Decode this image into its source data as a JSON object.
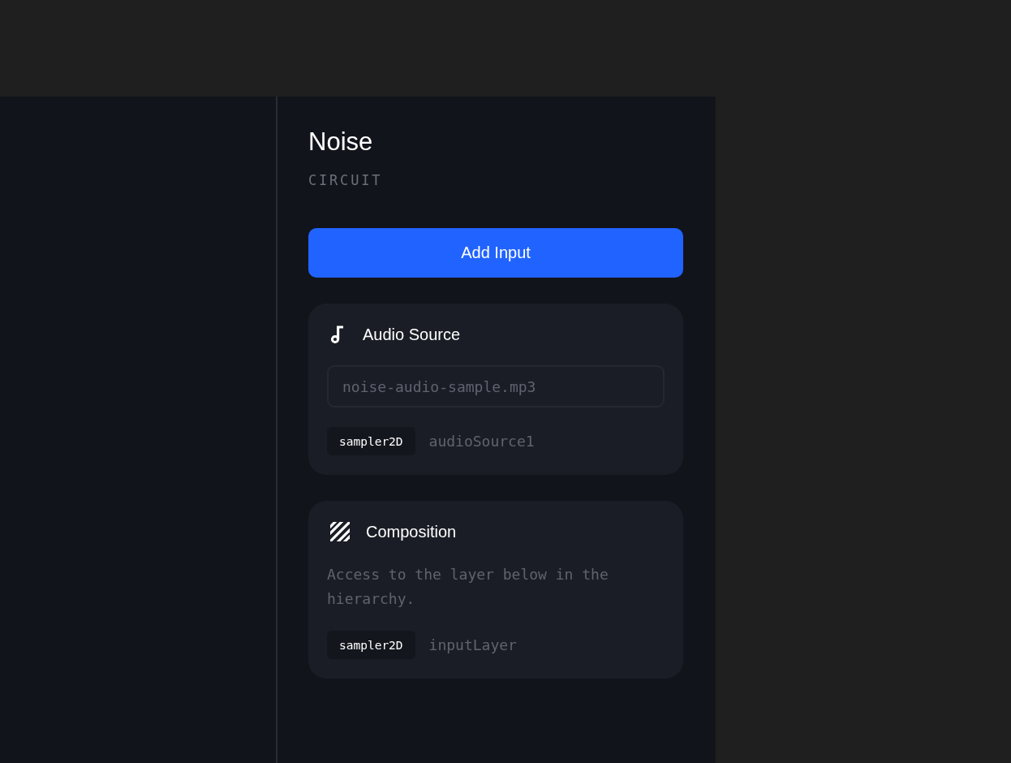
{
  "panel": {
    "title": "Noise",
    "subtitle": "CIRCUIT"
  },
  "add_button": {
    "label": "Add Input"
  },
  "inputs": [
    {
      "kind": "audio",
      "title": "Audio Source",
      "field": {
        "value": "noise-audio-sample.mp3"
      },
      "type": "sampler2D",
      "name": "audioSource1"
    },
    {
      "kind": "composition",
      "title": "Composition",
      "description": "Access to the layer below in the hierarchy.",
      "type": "sampler2D",
      "name": "inputLayer"
    }
  ]
}
